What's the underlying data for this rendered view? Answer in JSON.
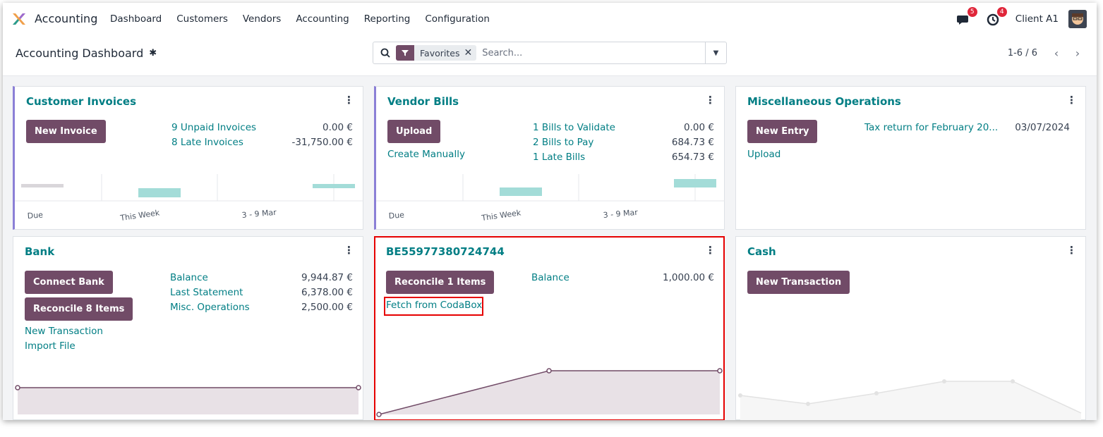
{
  "navbar": {
    "app_name": "Accounting",
    "menu": [
      "Dashboard",
      "Customers",
      "Vendors",
      "Accounting",
      "Reporting",
      "Configuration"
    ],
    "messages_badge": "5",
    "activities_badge": "4",
    "user": "Client A1"
  },
  "control_panel": {
    "title": "Accounting Dashboard",
    "facet_label": "Favorites",
    "search_placeholder": "Search...",
    "pager": "1-6 / 6"
  },
  "cards": {
    "customer_invoices": {
      "title": "Customer Invoices",
      "button": "New Invoice",
      "rows": [
        {
          "label": "9 Unpaid Invoices",
          "amount": "0.00 €"
        },
        {
          "label": "8 Late Invoices",
          "amount": "-31,750.00 €"
        }
      ],
      "chart_labels": [
        "Due",
        "This Week",
        "3 - 9 Mar"
      ]
    },
    "vendor_bills": {
      "title": "Vendor Bills",
      "button": "Upload",
      "create_link": "Create Manually",
      "rows": [
        {
          "label": "1 Bills to Validate",
          "amount": "0.00 €"
        },
        {
          "label": "2 Bills to Pay",
          "amount": "684.73 €"
        },
        {
          "label": "1 Late Bills",
          "amount": "654.73 €"
        }
      ],
      "chart_labels": [
        "Due",
        "This Week",
        "3 - 9 Mar"
      ]
    },
    "misc_operations": {
      "title": "Miscellaneous Operations",
      "button": "New Entry",
      "upload_link": "Upload",
      "entry_label": "Tax return for February 20...",
      "entry_date": "03/07/2024"
    },
    "bank": {
      "title": "Bank",
      "connect_button": "Connect Bank",
      "reconcile_button": "Reconcile 8 Items",
      "links": [
        "New Transaction",
        "Import File"
      ],
      "rows": [
        {
          "label": "Balance",
          "amount": "9,944.87 €"
        },
        {
          "label": "Last Statement",
          "amount": "6,378.00 €"
        },
        {
          "label": "Misc. Operations",
          "amount": "2,500.00 €"
        }
      ]
    },
    "be_account": {
      "title": "BE55977380724744",
      "reconcile_button": "Reconcile 1 Items",
      "fetch_link": "Fetch from CodaBox",
      "balance_label": "Balance",
      "balance_amount": "1,000.00 €"
    },
    "cash": {
      "title": "Cash",
      "button": "New Transaction"
    }
  },
  "colors": {
    "brand": "#714b67",
    "link": "#017e84",
    "accent_border": "#8b7fd6",
    "highlight": "#e60000",
    "bar": "#a3dcd8"
  }
}
